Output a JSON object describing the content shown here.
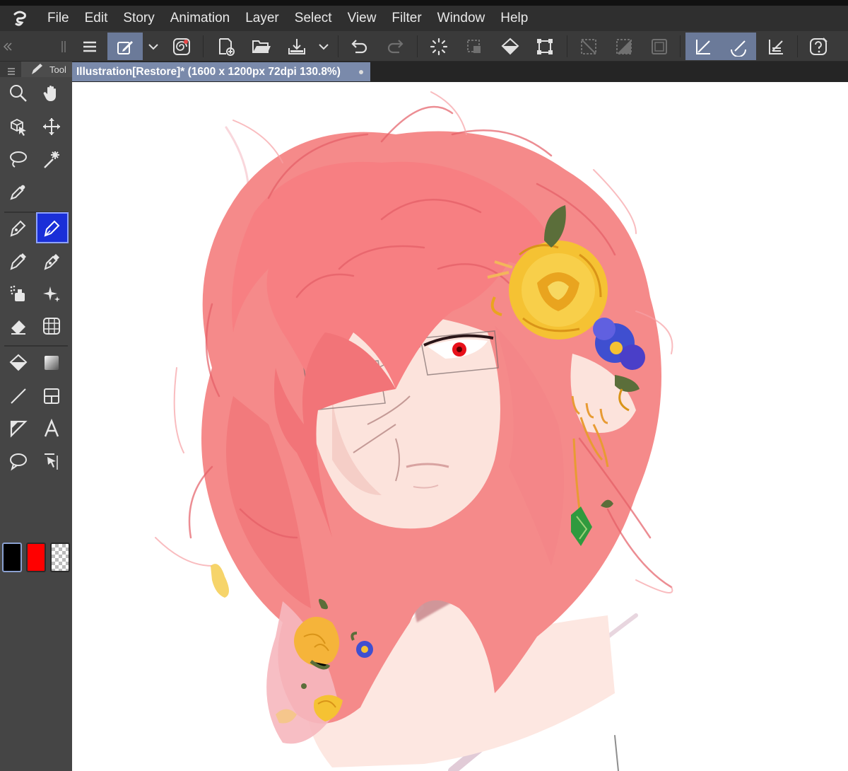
{
  "menubar": {
    "items": [
      "File",
      "Edit",
      "Story",
      "Animation",
      "Layer",
      "Select",
      "View",
      "Filter",
      "Window",
      "Help"
    ]
  },
  "document": {
    "tab_title": "Illustration[Restore]* (1600 x 1200px 72dpi 130.8%)"
  },
  "tool_palette": {
    "tab_label": "Tool"
  },
  "colors": {
    "main_color": "#000000",
    "sub_color": "#ff0000",
    "transparent": "checker",
    "accent": "#6b7a99",
    "active_tool": "#1a2fd8"
  },
  "command_bar_icons": [
    "menu-icon",
    "edit-layer-icon",
    "dropdown-icon",
    "spiral-icon",
    "new-icon",
    "open-icon",
    "save-icon",
    "dropdown-icon",
    "undo-icon",
    "redo-icon",
    "clear-icon",
    "crop-icon",
    "fill-icon",
    "transform-icon",
    "deselect-icon",
    "invert-icon",
    "border-icon",
    "snap-ruler-icon",
    "snap-special-ruler-icon",
    "snap-grid-icon",
    "help-icon"
  ],
  "tools": [
    "zoom-icon",
    "hand-icon",
    "operation-icon",
    "move-icon",
    "lasso-select-icon",
    "magic-wand-icon",
    "eyedropper-icon",
    "pen-icon",
    "pen-active-icon",
    "pencil-icon",
    "brush-icon",
    "airbrush-icon",
    "decoration-icon",
    "eraser-icon",
    "blend-icon",
    "fill-icon",
    "gradient-icon",
    "figure-icon",
    "frame-icon",
    "ruler-icon",
    "text-icon",
    "balloon-icon",
    "correct-line-icon"
  ]
}
